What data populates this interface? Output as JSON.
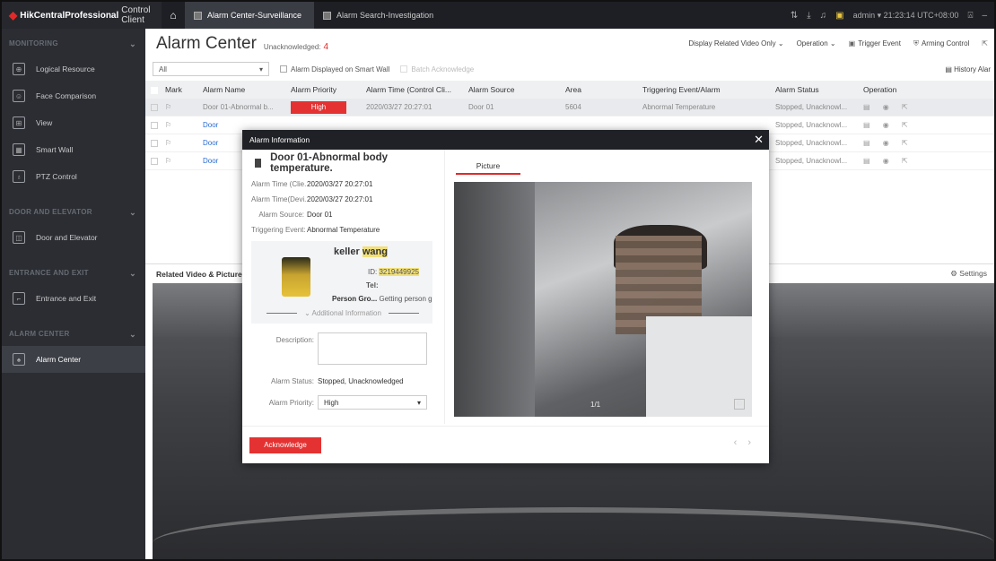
{
  "app": {
    "brand": "HikCentral",
    "brand_suffix": "Professional",
    "brand_client": "Control Client",
    "tabs": [
      {
        "label": "Alarm Center-Surveillance"
      },
      {
        "label": "Alarm Search-Investigation"
      }
    ],
    "user": "admin",
    "time": "21:23:14 UTC+08:00"
  },
  "sidebar": {
    "sections": [
      {
        "title": "MONITORING",
        "items": [
          {
            "label": "Logical Resource",
            "icon": "globe-icon"
          },
          {
            "label": "Face Comparison",
            "icon": "face-icon"
          },
          {
            "label": "View",
            "icon": "grid-icon"
          },
          {
            "label": "Smart Wall",
            "icon": "wall-icon"
          },
          {
            "label": "PTZ Control",
            "icon": "ptz-icon"
          }
        ]
      },
      {
        "title": "DOOR AND ELEVATOR",
        "items": [
          {
            "label": "Door and Elevator",
            "icon": "door-icon"
          }
        ]
      },
      {
        "title": "ENTRANCE AND EXIT",
        "items": [
          {
            "label": "Entrance and Exit",
            "icon": "barrier-icon"
          }
        ]
      },
      {
        "title": "ALARM CENTER",
        "items": [
          {
            "label": "Alarm Center",
            "icon": "bell-icon"
          }
        ]
      }
    ]
  },
  "main": {
    "title": "Alarm Center",
    "unack_label": "Unacknowledged:",
    "unack_count": "4",
    "tools": {
      "related_video": "Display Related Video Only",
      "operation": "Operation",
      "trigger_event": "Trigger Event",
      "arming_control": "Arming Control"
    },
    "filter": {
      "select_value": "All",
      "smart_wall": "Alarm Displayed on Smart Wall",
      "batch_ack": "Batch Acknowledge",
      "history": "History Alar"
    },
    "table": {
      "headers": [
        "Mark",
        "Alarm Name",
        "Alarm Priority",
        "Alarm Time (Control Cli...",
        "Alarm Source",
        "Area",
        "Triggering Event/Alarm",
        "Alarm Status",
        "Operation"
      ],
      "rows": [
        {
          "name": "Door 01-Abnormal b...",
          "priority": "High",
          "time": "2020/03/27 20:27:01",
          "source": "Door 01",
          "area": "5604",
          "event": "Abnormal Temperature",
          "status": "Stopped, Unacknowl..."
        },
        {
          "name": "Door",
          "priority": "",
          "time": "",
          "source": "",
          "area": "",
          "event": "",
          "status": "Stopped, Unacknowl..."
        },
        {
          "name": "Door",
          "priority": "",
          "time": "",
          "source": "",
          "area": "",
          "event": "",
          "status": "Stopped, Unacknowl..."
        },
        {
          "name": "Door",
          "priority": "",
          "time": "",
          "source": "",
          "area": "",
          "event": "",
          "status": "Stopped, Unacknowl..."
        }
      ]
    },
    "related_title": "Related Video & Picture",
    "settings_label": "Settings"
  },
  "modal": {
    "header": "Alarm Information",
    "title": "Door 01-Abnormal body temperature.",
    "fields": [
      {
        "k": "Alarm Time (Clie...",
        "v": "2020/03/27 20:27:01"
      },
      {
        "k": "Alarm Time(Devi...",
        "v": "2020/03/27 20:27:01"
      },
      {
        "k": "Alarm Source:",
        "v": "Door 01"
      },
      {
        "k": "Triggering Event:",
        "v": "Abnormal Temperature"
      }
    ],
    "person": {
      "first_name": "keller",
      "last_name": "wang",
      "id_label": "ID:",
      "id_value": "3219449925",
      "tel_label": "Tel:",
      "group_label": "Person Gro...",
      "group_value": "Getting person gr...",
      "additional": "Additional Information"
    },
    "description_label": "Description:",
    "status_label": "Alarm Status:",
    "status_value": "Stopped, Unacknowledged",
    "priority_label": "Alarm Priority:",
    "priority_value": "High",
    "picture_tab": "Picture",
    "picture_counter": "1/1",
    "ack_button": "Acknowledge"
  },
  "colors": {
    "accent": "#e43232",
    "topbar": "#1d1f24",
    "sidebar": "#2b2d33"
  }
}
